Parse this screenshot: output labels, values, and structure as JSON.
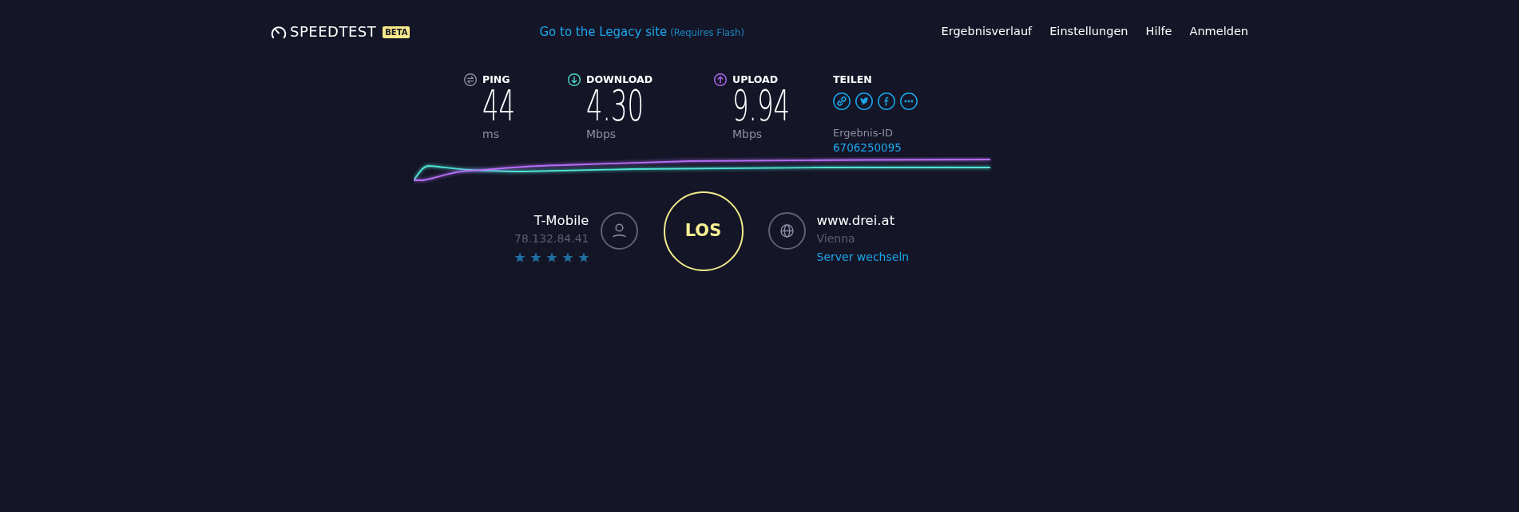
{
  "header": {
    "logo": {
      "text": "SPEEDTEST",
      "badge": "BETA"
    },
    "legacy": {
      "link": "Go to the Legacy site",
      "note": "(Requires Flash)"
    },
    "nav": [
      "Ergebnisverlauf",
      "Einstellungen",
      "Hilfe",
      "Anmelden"
    ]
  },
  "metrics": [
    {
      "kind": "ping",
      "label": "PING",
      "value": "44",
      "unit": "ms"
    },
    {
      "kind": "download",
      "label": "DOWNLOAD",
      "value": "4.30",
      "unit": "Mbps"
    },
    {
      "kind": "upload",
      "label": "UPLOAD",
      "value": "9.94",
      "unit": "Mbps"
    }
  ],
  "share": {
    "title": "TEILEN",
    "result_label": "Ergebnis-ID",
    "result_id": "6706250095"
  },
  "isp": {
    "name": "T-Mobile",
    "ip": "78.132.84.41",
    "stars": 5
  },
  "go_button": {
    "label": "LOS"
  },
  "server": {
    "name": "www.drei.at",
    "location": "Vienna",
    "change_link": "Server wechseln"
  }
}
